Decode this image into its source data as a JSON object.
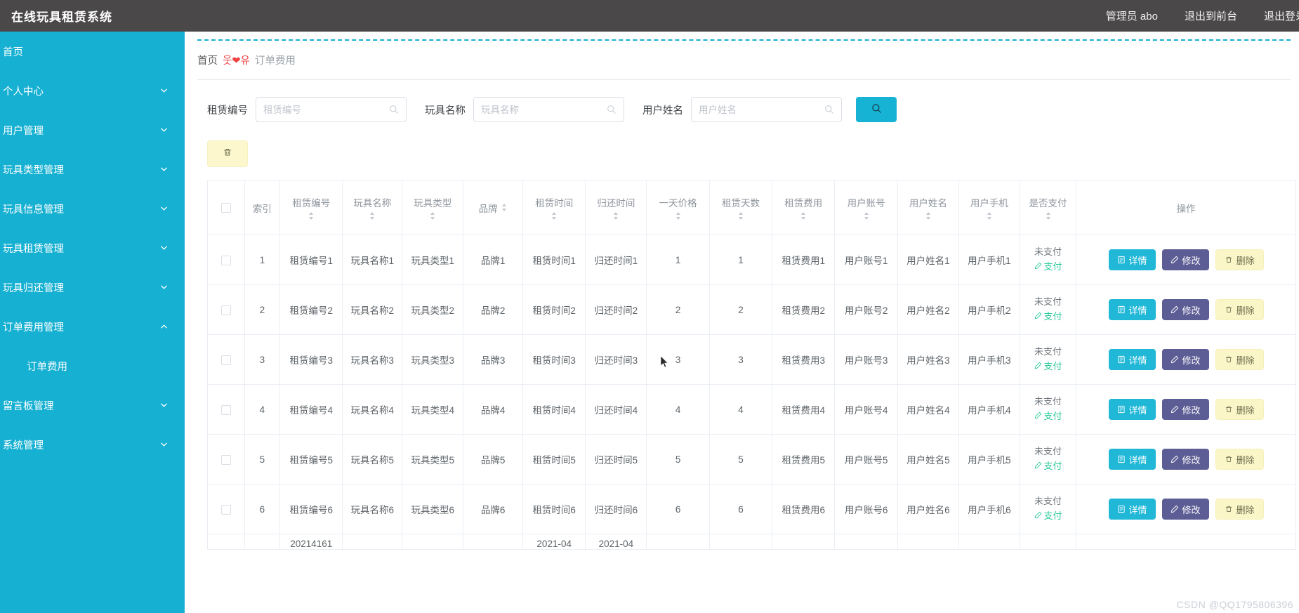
{
  "app": {
    "title": "在线玩具租赁系统",
    "header_links": [
      "管理员 abo",
      "退出到前台",
      "退出登录"
    ],
    "colors": {
      "header_bg": "#4a4848",
      "sidebar_bg": "#16b0d2",
      "accent": "#17b3d4",
      "edit": "#5d5d96",
      "delete": "#fbf6c8",
      "pay_link": "#28c99a",
      "breadcrumb_sep": "#ee2222"
    }
  },
  "sidebar": {
    "items": [
      {
        "label": "首页",
        "icon": "",
        "expandable": false,
        "sub": false
      },
      {
        "label": "个人中心",
        "icon": "chevron-down-icon",
        "expandable": true,
        "sub": false
      },
      {
        "label": "用户管理",
        "icon": "chevron-down-icon",
        "expandable": true,
        "sub": false
      },
      {
        "label": "玩具类型管理",
        "icon": "chevron-down-icon",
        "expandable": true,
        "sub": false
      },
      {
        "label": "玩具信息管理",
        "icon": "chevron-down-icon",
        "expandable": true,
        "sub": false
      },
      {
        "label": "玩具租赁管理",
        "icon": "chevron-down-icon",
        "expandable": true,
        "sub": false
      },
      {
        "label": "玩具归还管理",
        "icon": "chevron-down-icon",
        "expandable": true,
        "sub": false
      },
      {
        "label": "订单费用管理",
        "icon": "chevron-up-icon",
        "expandable": true,
        "sub": false
      },
      {
        "label": "订单费用",
        "icon": "",
        "expandable": false,
        "sub": true
      },
      {
        "label": "留言板管理",
        "icon": "chevron-down-icon",
        "expandable": true,
        "sub": false
      },
      {
        "label": "系统管理",
        "icon": "chevron-down-icon",
        "expandable": true,
        "sub": false
      }
    ]
  },
  "breadcrumb": {
    "home": "首页",
    "separator": "웃❤유",
    "current": "订单费用"
  },
  "filters": [
    {
      "label": "租赁编号",
      "placeholder": "租赁编号",
      "value": "",
      "icon": "search-icon"
    },
    {
      "label": "玩具名称",
      "placeholder": "玩具名称",
      "value": "",
      "icon": "search-icon"
    },
    {
      "label": "用户姓名",
      "placeholder": "用户姓名",
      "value": "",
      "icon": "search-icon"
    }
  ],
  "toolbar": {
    "search_icon": "search-icon",
    "bulk_delete_icon": "trash-icon"
  },
  "table": {
    "select_all_checked": false,
    "columns": [
      {
        "key": "checkbox",
        "label": "",
        "sortable": false
      },
      {
        "key": "index",
        "label": "索引",
        "sortable": false
      },
      {
        "key": "rent_no",
        "label": "租赁编号",
        "sortable": true
      },
      {
        "key": "toy_name",
        "label": "玩具名称",
        "sortable": true
      },
      {
        "key": "toy_type",
        "label": "玩具类型",
        "sortable": true
      },
      {
        "key": "brand",
        "label": "品牌",
        "sortable": true,
        "inline": true
      },
      {
        "key": "rent_time",
        "label": "租赁时间",
        "sortable": true
      },
      {
        "key": "return_time",
        "label": "归还时间",
        "sortable": true
      },
      {
        "key": "day_price",
        "label": "一天价格",
        "sortable": true
      },
      {
        "key": "rent_days",
        "label": "租赁天数",
        "sortable": true
      },
      {
        "key": "rent_fee",
        "label": "租赁费用",
        "sortable": true
      },
      {
        "key": "user_account",
        "label": "用户账号",
        "sortable": true
      },
      {
        "key": "user_name",
        "label": "用户姓名",
        "sortable": true
      },
      {
        "key": "user_phone",
        "label": "用户手机",
        "sortable": true
      },
      {
        "key": "is_paid",
        "label": "是否支付",
        "sortable": true
      },
      {
        "key": "ops",
        "label": "操作",
        "sortable": false
      }
    ],
    "rows": [
      {
        "index": "1",
        "rent_no": "租赁编号1",
        "toy_name": "玩具名称1",
        "toy_type": "玩具类型1",
        "brand": "品牌1",
        "rent_time": "租赁时间1",
        "return_time": "归还时间1",
        "day_price": "1",
        "rent_days": "1",
        "rent_fee": "租赁费用1",
        "user_account": "用户账号1",
        "user_name": "用户姓名1",
        "user_phone": "用户手机1",
        "pay_status": "未支付",
        "pay_link": "支付"
      },
      {
        "index": "2",
        "rent_no": "租赁编号2",
        "toy_name": "玩具名称2",
        "toy_type": "玩具类型2",
        "brand": "品牌2",
        "rent_time": "租赁时间2",
        "return_time": "归还时间2",
        "day_price": "2",
        "rent_days": "2",
        "rent_fee": "租赁费用2",
        "user_account": "用户账号2",
        "user_name": "用户姓名2",
        "user_phone": "用户手机2",
        "pay_status": "未支付",
        "pay_link": "支付"
      },
      {
        "index": "3",
        "rent_no": "租赁编号3",
        "toy_name": "玩具名称3",
        "toy_type": "玩具类型3",
        "brand": "品牌3",
        "rent_time": "租赁时间3",
        "return_time": "归还时间3",
        "day_price": "3",
        "rent_days": "3",
        "rent_fee": "租赁费用3",
        "user_account": "用户账号3",
        "user_name": "用户姓名3",
        "user_phone": "用户手机3",
        "pay_status": "未支付",
        "pay_link": "支付"
      },
      {
        "index": "4",
        "rent_no": "租赁编号4",
        "toy_name": "玩具名称4",
        "toy_type": "玩具类型4",
        "brand": "品牌4",
        "rent_time": "租赁时间4",
        "return_time": "归还时间4",
        "day_price": "4",
        "rent_days": "4",
        "rent_fee": "租赁费用4",
        "user_account": "用户账号4",
        "user_name": "用户姓名4",
        "user_phone": "用户手机4",
        "pay_status": "未支付",
        "pay_link": "支付"
      },
      {
        "index": "5",
        "rent_no": "租赁编号5",
        "toy_name": "玩具名称5",
        "toy_type": "玩具类型5",
        "brand": "品牌5",
        "rent_time": "租赁时间5",
        "return_time": "归还时间5",
        "day_price": "5",
        "rent_days": "5",
        "rent_fee": "租赁费用5",
        "user_account": "用户账号5",
        "user_name": "用户姓名5",
        "user_phone": "用户手机5",
        "pay_status": "未支付",
        "pay_link": "支付"
      },
      {
        "index": "6",
        "rent_no": "租赁编号6",
        "toy_name": "玩具名称6",
        "toy_type": "玩具类型6",
        "brand": "品牌6",
        "rent_time": "租赁时间6",
        "return_time": "归还时间6",
        "day_price": "6",
        "rent_days": "6",
        "rent_fee": "租赁费用6",
        "user_account": "用户账号6",
        "user_name": "用户姓名6",
        "user_phone": "用户手机6",
        "pay_status": "未支付",
        "pay_link": "支付"
      },
      {
        "index": "",
        "rent_no": "20214161",
        "toy_name": "",
        "toy_type": "",
        "brand": "",
        "rent_time": "2021-04",
        "return_time": "2021-04",
        "day_price": "",
        "rent_days": "",
        "rent_fee": "",
        "user_account": "",
        "user_name": "",
        "user_phone": "",
        "pay_status": "",
        "pay_link": ""
      }
    ],
    "row_buttons": {
      "detail": "详情",
      "edit": "修改",
      "delete": "删除",
      "detail_icon": "document-icon",
      "edit_icon": "pencil-icon",
      "delete_icon": "trash-icon"
    }
  },
  "watermark": "CSDN @QQ1795806396"
}
